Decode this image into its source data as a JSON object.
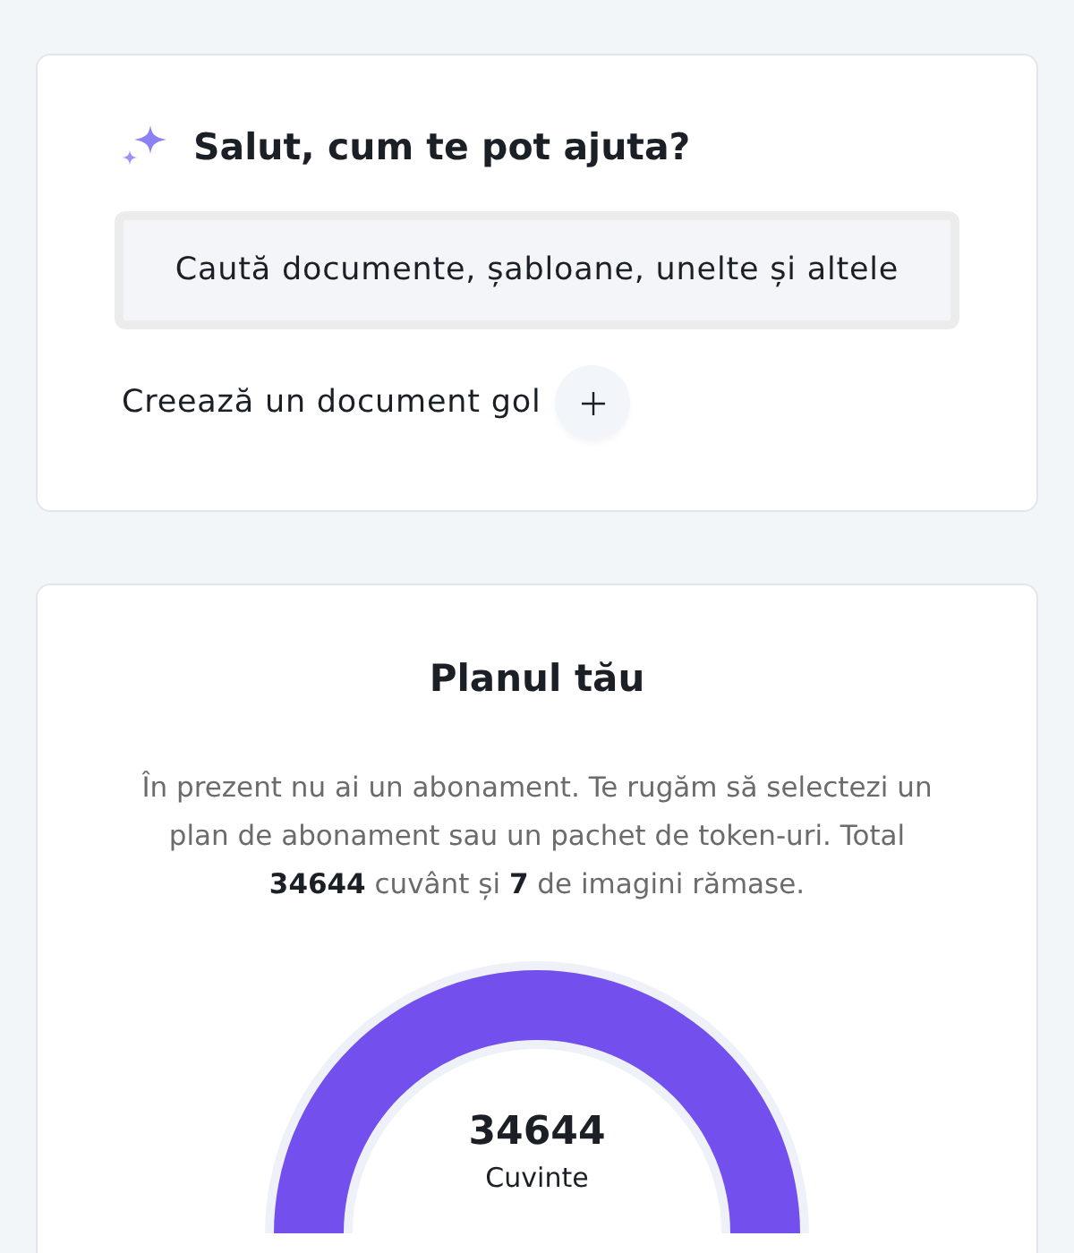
{
  "greeting_card": {
    "title": "Salut, cum te pot ajuta?",
    "search": {
      "placeholder": "Caută documente, șabloane, unelte și altele"
    },
    "create_action": {
      "label": "Creează un document gol"
    }
  },
  "plan_card": {
    "title": "Planul tău",
    "description": "În prezent nu ai un abonament. Te rugăm să selectezi un plan de abonament sau un pachet de token-uri. Total **34644** cuvânt și **7** de imagini rămase.",
    "gauge": {
      "level": 1,
      "value": "34644",
      "label": "Cuvinte"
    }
  }
}
